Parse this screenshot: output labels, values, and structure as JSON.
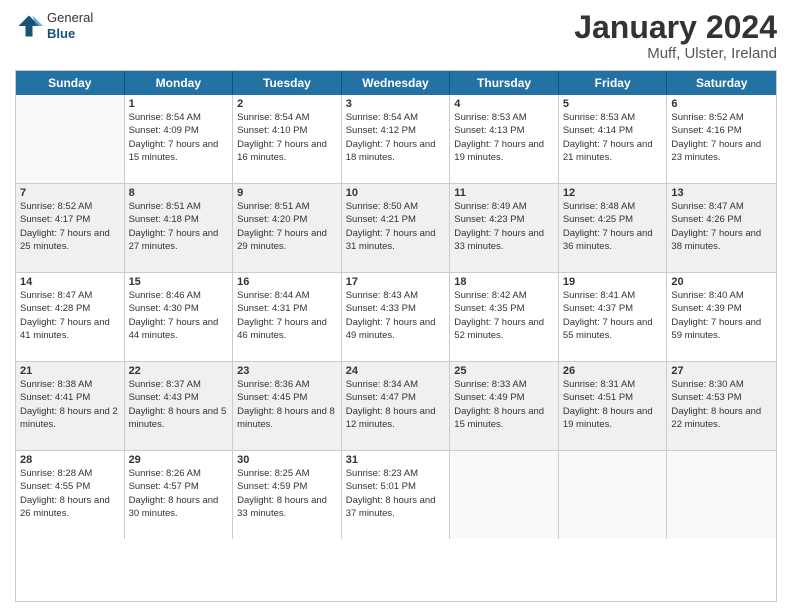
{
  "header": {
    "logo_general": "General",
    "logo_blue": "Blue",
    "month_title": "January 2024",
    "location": "Muff, Ulster, Ireland"
  },
  "days_of_week": [
    "Sunday",
    "Monday",
    "Tuesday",
    "Wednesday",
    "Thursday",
    "Friday",
    "Saturday"
  ],
  "weeks": [
    [
      {
        "day": "",
        "empty": true
      },
      {
        "day": "1",
        "sunrise": "Sunrise: 8:54 AM",
        "sunset": "Sunset: 4:09 PM",
        "daylight": "Daylight: 7 hours and 15 minutes."
      },
      {
        "day": "2",
        "sunrise": "Sunrise: 8:54 AM",
        "sunset": "Sunset: 4:10 PM",
        "daylight": "Daylight: 7 hours and 16 minutes."
      },
      {
        "day": "3",
        "sunrise": "Sunrise: 8:54 AM",
        "sunset": "Sunset: 4:12 PM",
        "daylight": "Daylight: 7 hours and 18 minutes."
      },
      {
        "day": "4",
        "sunrise": "Sunrise: 8:53 AM",
        "sunset": "Sunset: 4:13 PM",
        "daylight": "Daylight: 7 hours and 19 minutes."
      },
      {
        "day": "5",
        "sunrise": "Sunrise: 8:53 AM",
        "sunset": "Sunset: 4:14 PM",
        "daylight": "Daylight: 7 hours and 21 minutes."
      },
      {
        "day": "6",
        "sunrise": "Sunrise: 8:52 AM",
        "sunset": "Sunset: 4:16 PM",
        "daylight": "Daylight: 7 hours and 23 minutes."
      }
    ],
    [
      {
        "day": "7",
        "sunrise": "Sunrise: 8:52 AM",
        "sunset": "Sunset: 4:17 PM",
        "daylight": "Daylight: 7 hours and 25 minutes."
      },
      {
        "day": "8",
        "sunrise": "Sunrise: 8:51 AM",
        "sunset": "Sunset: 4:18 PM",
        "daylight": "Daylight: 7 hours and 27 minutes."
      },
      {
        "day": "9",
        "sunrise": "Sunrise: 8:51 AM",
        "sunset": "Sunset: 4:20 PM",
        "daylight": "Daylight: 7 hours and 29 minutes."
      },
      {
        "day": "10",
        "sunrise": "Sunrise: 8:50 AM",
        "sunset": "Sunset: 4:21 PM",
        "daylight": "Daylight: 7 hours and 31 minutes."
      },
      {
        "day": "11",
        "sunrise": "Sunrise: 8:49 AM",
        "sunset": "Sunset: 4:23 PM",
        "daylight": "Daylight: 7 hours and 33 minutes."
      },
      {
        "day": "12",
        "sunrise": "Sunrise: 8:48 AM",
        "sunset": "Sunset: 4:25 PM",
        "daylight": "Daylight: 7 hours and 36 minutes."
      },
      {
        "day": "13",
        "sunrise": "Sunrise: 8:47 AM",
        "sunset": "Sunset: 4:26 PM",
        "daylight": "Daylight: 7 hours and 38 minutes."
      }
    ],
    [
      {
        "day": "14",
        "sunrise": "Sunrise: 8:47 AM",
        "sunset": "Sunset: 4:28 PM",
        "daylight": "Daylight: 7 hours and 41 minutes."
      },
      {
        "day": "15",
        "sunrise": "Sunrise: 8:46 AM",
        "sunset": "Sunset: 4:30 PM",
        "daylight": "Daylight: 7 hours and 44 minutes."
      },
      {
        "day": "16",
        "sunrise": "Sunrise: 8:44 AM",
        "sunset": "Sunset: 4:31 PM",
        "daylight": "Daylight: 7 hours and 46 minutes."
      },
      {
        "day": "17",
        "sunrise": "Sunrise: 8:43 AM",
        "sunset": "Sunset: 4:33 PM",
        "daylight": "Daylight: 7 hours and 49 minutes."
      },
      {
        "day": "18",
        "sunrise": "Sunrise: 8:42 AM",
        "sunset": "Sunset: 4:35 PM",
        "daylight": "Daylight: 7 hours and 52 minutes."
      },
      {
        "day": "19",
        "sunrise": "Sunrise: 8:41 AM",
        "sunset": "Sunset: 4:37 PM",
        "daylight": "Daylight: 7 hours and 55 minutes."
      },
      {
        "day": "20",
        "sunrise": "Sunrise: 8:40 AM",
        "sunset": "Sunset: 4:39 PM",
        "daylight": "Daylight: 7 hours and 59 minutes."
      }
    ],
    [
      {
        "day": "21",
        "sunrise": "Sunrise: 8:38 AM",
        "sunset": "Sunset: 4:41 PM",
        "daylight": "Daylight: 8 hours and 2 minutes."
      },
      {
        "day": "22",
        "sunrise": "Sunrise: 8:37 AM",
        "sunset": "Sunset: 4:43 PM",
        "daylight": "Daylight: 8 hours and 5 minutes."
      },
      {
        "day": "23",
        "sunrise": "Sunrise: 8:36 AM",
        "sunset": "Sunset: 4:45 PM",
        "daylight": "Daylight: 8 hours and 8 minutes."
      },
      {
        "day": "24",
        "sunrise": "Sunrise: 8:34 AM",
        "sunset": "Sunset: 4:47 PM",
        "daylight": "Daylight: 8 hours and 12 minutes."
      },
      {
        "day": "25",
        "sunrise": "Sunrise: 8:33 AM",
        "sunset": "Sunset: 4:49 PM",
        "daylight": "Daylight: 8 hours and 15 minutes."
      },
      {
        "day": "26",
        "sunrise": "Sunrise: 8:31 AM",
        "sunset": "Sunset: 4:51 PM",
        "daylight": "Daylight: 8 hours and 19 minutes."
      },
      {
        "day": "27",
        "sunrise": "Sunrise: 8:30 AM",
        "sunset": "Sunset: 4:53 PM",
        "daylight": "Daylight: 8 hours and 22 minutes."
      }
    ],
    [
      {
        "day": "28",
        "sunrise": "Sunrise: 8:28 AM",
        "sunset": "Sunset: 4:55 PM",
        "daylight": "Daylight: 8 hours and 26 minutes."
      },
      {
        "day": "29",
        "sunrise": "Sunrise: 8:26 AM",
        "sunset": "Sunset: 4:57 PM",
        "daylight": "Daylight: 8 hours and 30 minutes."
      },
      {
        "day": "30",
        "sunrise": "Sunrise: 8:25 AM",
        "sunset": "Sunset: 4:59 PM",
        "daylight": "Daylight: 8 hours and 33 minutes."
      },
      {
        "day": "31",
        "sunrise": "Sunrise: 8:23 AM",
        "sunset": "Sunset: 5:01 PM",
        "daylight": "Daylight: 8 hours and 37 minutes."
      },
      {
        "day": "",
        "empty": true
      },
      {
        "day": "",
        "empty": true
      },
      {
        "day": "",
        "empty": true
      }
    ]
  ]
}
